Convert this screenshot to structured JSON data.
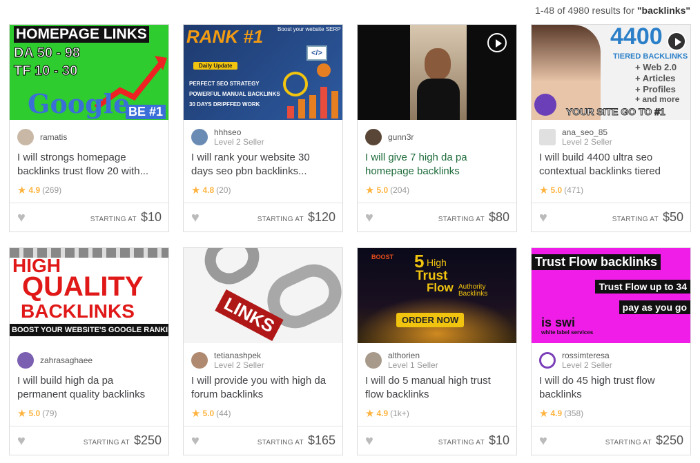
{
  "results": {
    "range": "1-48 of 4980 results for",
    "query": "\"backlinks\""
  },
  "labels": {
    "starting_at": "STARTING AT"
  },
  "thumbs": {
    "t1": {
      "line1": "HOMEPAGE LINKS",
      "line2": "DA 50 - 98",
      "line3": "TF 10 - 30",
      "google": "Google",
      "be": "BE #1"
    },
    "t2": {
      "rank": "RANK #1",
      "tag": "Boost your website SERP",
      "daily": "Daily Update",
      "b1": "PERFECT SEO STRATEGY",
      "b2": "POWERFUL MANUAL BACKLINKS",
      "b3": "30 DAYS DRIPFFED WORK",
      "code": "</>"
    },
    "t4": {
      "num": "4400",
      "l1": "TIERED BACKLINKS",
      "l2": "+ Web 2.0",
      "l3": "+ Articles",
      "l4": "+ Profiles",
      "l5": "+ and more",
      "bottom": "YOUR SITE GO TO #1"
    },
    "t5": {
      "l1": "HIGH",
      "l2": "QUALITY",
      "l3": "BACKLINKS",
      "l4": "BOOST YOUR WEBSITE'S GOOGLE RANKING!"
    },
    "t6": {
      "word": "LINKS"
    },
    "t7": {
      "boost": "BOOST",
      "num": "5",
      "l1": "High",
      "l2": "Trust",
      "l3": "Flow",
      "auth": "Authority Backlinks",
      "order": "ORDER NOW"
    },
    "t8": {
      "title": "Trust Flow backlinks",
      "l1": "Trust Flow up to 34",
      "l2": "pay as you go",
      "brand": "is swi",
      "brand2": "white label services"
    }
  },
  "gigs": [
    {
      "seller": "ramatis",
      "level": "",
      "title": "I will strongs homepage backlinks trust flow 20 with...",
      "rating": "4.9",
      "count": "(269)",
      "price": "$10"
    },
    {
      "seller": "hhhseo",
      "level": "Level 2 Seller",
      "title": "I will rank your website 30 days seo pbn backlinks...",
      "rating": "4.8",
      "count": "(20)",
      "price": "$120"
    },
    {
      "seller": "gunn3r",
      "level": "",
      "title": "I will give 7 high da pa homepage backlinks",
      "rating": "5.0",
      "count": "(204)",
      "price": "$80"
    },
    {
      "seller": "ana_seo_85",
      "level": "Level 2 Seller",
      "title": "I will build 4400 ultra seo contextual backlinks tiered",
      "rating": "5.0",
      "count": "(471)",
      "price": "$50"
    },
    {
      "seller": "zahrasaghaee",
      "level": "",
      "title": "I will build high da pa permanent quality backlinks",
      "rating": "5.0",
      "count": "(79)",
      "price": "$250"
    },
    {
      "seller": "tetianashpek",
      "level": "Level 2 Seller",
      "title": "I will provide you with high da forum backlinks",
      "rating": "5.0",
      "count": "(44)",
      "price": "$165"
    },
    {
      "seller": "althorien",
      "level": "Level 1 Seller",
      "title": "I will do 5 manual high trust flow backlinks",
      "rating": "4.9",
      "count": "(1k+)",
      "price": "$10"
    },
    {
      "seller": "rossimteresa",
      "level": "Level 2 Seller",
      "title": "I will do 45 high trust flow backlinks",
      "rating": "4.9",
      "count": "(358)",
      "price": "$250"
    }
  ],
  "colors": {
    "star": "#ffb33e",
    "heart": "#bbbbbb",
    "green_title": "#1d6b3a"
  },
  "icons": {
    "star": "star-icon",
    "heart": "heart-icon",
    "play": "play-icon"
  }
}
